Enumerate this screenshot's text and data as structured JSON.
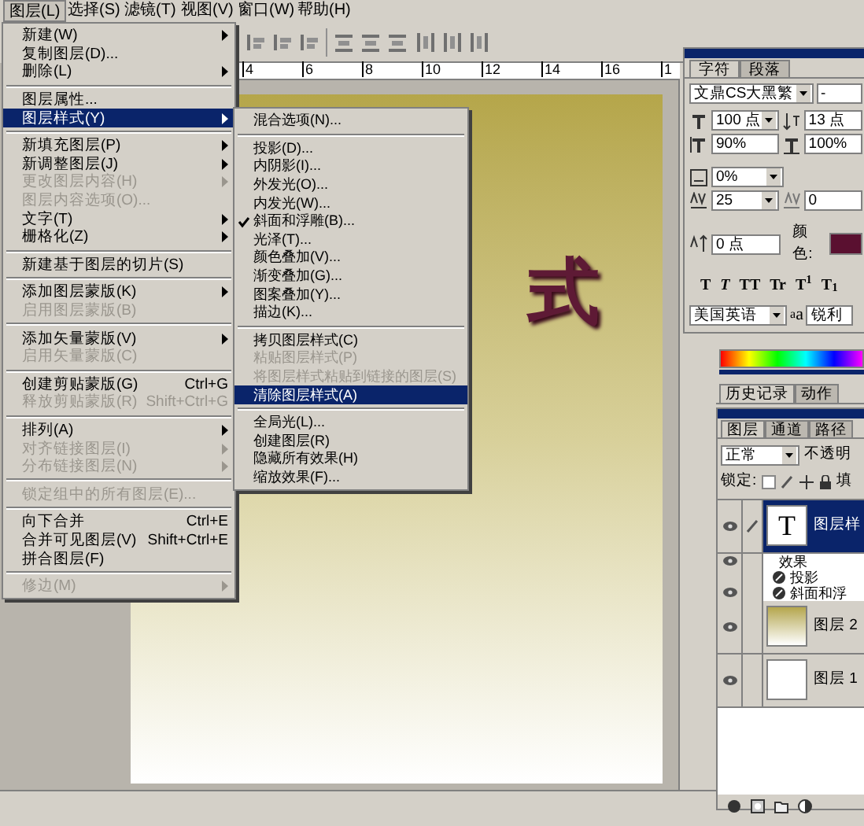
{
  "menu_bar": [
    {
      "label": "图层(L)",
      "selected": true
    },
    {
      "label": "选择(S)",
      "selected": false
    },
    {
      "label": "滤镜(T)",
      "selected": false
    },
    {
      "label": "视图(V)",
      "selected": false
    },
    {
      "label": "窗口(W)",
      "selected": false
    },
    {
      "label": "帮助(H)",
      "selected": false
    }
  ],
  "ruler": [
    "4",
    "6",
    "8",
    "10",
    "12",
    "14",
    "16",
    "1"
  ],
  "canvas": {
    "text": "式"
  },
  "layer_menu": [
    {
      "kind": "item",
      "label": "新建(W)",
      "submenu": true,
      "disabled": false,
      "selected": false
    },
    {
      "kind": "item",
      "label": "复制图层(D)...",
      "submenu": false,
      "disabled": false,
      "selected": false
    },
    {
      "kind": "item",
      "label": "删除(L)",
      "submenu": true,
      "disabled": false,
      "selected": false
    },
    {
      "kind": "separator"
    },
    {
      "kind": "item",
      "label": "图层属性...",
      "submenu": false,
      "disabled": false,
      "selected": false
    },
    {
      "kind": "item",
      "label": "图层样式(Y)",
      "submenu": true,
      "disabled": false,
      "selected": true
    },
    {
      "kind": "separator"
    },
    {
      "kind": "item",
      "label": "新填充图层(P)",
      "submenu": true,
      "disabled": false,
      "selected": false
    },
    {
      "kind": "item",
      "label": "新调整图层(J)",
      "submenu": true,
      "disabled": false,
      "selected": false
    },
    {
      "kind": "item",
      "label": "更改图层内容(H)",
      "submenu": true,
      "disabled": true,
      "selected": false
    },
    {
      "kind": "item",
      "label": "图层内容选项(O)...",
      "submenu": false,
      "disabled": true,
      "selected": false
    },
    {
      "kind": "item",
      "label": "文字(T)",
      "submenu": true,
      "disabled": false,
      "selected": false
    },
    {
      "kind": "item",
      "label": "栅格化(Z)",
      "submenu": true,
      "disabled": false,
      "selected": false
    },
    {
      "kind": "separator"
    },
    {
      "kind": "item",
      "label": "新建基于图层的切片(S)",
      "submenu": false,
      "disabled": false,
      "selected": false
    },
    {
      "kind": "separator"
    },
    {
      "kind": "item",
      "label": "添加图层蒙版(K)",
      "submenu": true,
      "disabled": false,
      "selected": false
    },
    {
      "kind": "item",
      "label": "启用图层蒙版(B)",
      "submenu": false,
      "disabled": true,
      "selected": false
    },
    {
      "kind": "separator"
    },
    {
      "kind": "item",
      "label": "添加矢量蒙版(V)",
      "submenu": true,
      "disabled": false,
      "selected": false
    },
    {
      "kind": "item",
      "label": "启用矢量蒙版(C)",
      "submenu": false,
      "disabled": true,
      "selected": false
    },
    {
      "kind": "separator"
    },
    {
      "kind": "item",
      "label": "创建剪贴蒙版(G)",
      "shortcut": "Ctrl+G",
      "submenu": false,
      "disabled": false,
      "selected": false
    },
    {
      "kind": "item",
      "label": "释放剪贴蒙版(R)",
      "shortcut": "Shift+Ctrl+G",
      "submenu": false,
      "disabled": true,
      "selected": false
    },
    {
      "kind": "separator"
    },
    {
      "kind": "item",
      "label": "排列(A)",
      "submenu": true,
      "disabled": false,
      "selected": false
    },
    {
      "kind": "item",
      "label": "对齐链接图层(I)",
      "submenu": true,
      "disabled": true,
      "selected": false
    },
    {
      "kind": "item",
      "label": "分布链接图层(N)",
      "submenu": true,
      "disabled": true,
      "selected": false
    },
    {
      "kind": "separator"
    },
    {
      "kind": "item",
      "label": "锁定组中的所有图层(E)...",
      "submenu": false,
      "disabled": true,
      "selected": false
    },
    {
      "kind": "separator"
    },
    {
      "kind": "item",
      "label": "向下合并",
      "shortcut": "Ctrl+E",
      "submenu": false,
      "disabled": false,
      "selected": false
    },
    {
      "kind": "item",
      "label": "合并可见图层(V)",
      "shortcut": "Shift+Ctrl+E",
      "submenu": false,
      "disabled": false,
      "selected": false
    },
    {
      "kind": "item",
      "label": "拼合图层(F)",
      "submenu": false,
      "disabled": false,
      "selected": false
    },
    {
      "kind": "separator"
    },
    {
      "kind": "item",
      "label": "修边(M)",
      "submenu": true,
      "disabled": true,
      "selected": false
    }
  ],
  "style_menu": [
    {
      "kind": "item",
      "label": "混合选项(N)...",
      "checked": false,
      "disabled": false,
      "selected": false
    },
    {
      "kind": "separator"
    },
    {
      "kind": "item",
      "label": "投影(D)...",
      "checked": false,
      "disabled": false,
      "selected": false
    },
    {
      "kind": "item",
      "label": "内阴影(I)...",
      "checked": false,
      "disabled": false,
      "selected": false
    },
    {
      "kind": "item",
      "label": "外发光(O)...",
      "checked": false,
      "disabled": false,
      "selected": false
    },
    {
      "kind": "item",
      "label": "内发光(W)...",
      "checked": false,
      "disabled": false,
      "selected": false
    },
    {
      "kind": "item",
      "label": "斜面和浮雕(B)...",
      "checked": true,
      "disabled": false,
      "selected": false
    },
    {
      "kind": "item",
      "label": "光泽(T)...",
      "checked": false,
      "disabled": false,
      "selected": false
    },
    {
      "kind": "item",
      "label": "颜色叠加(V)...",
      "checked": false,
      "disabled": false,
      "selected": false
    },
    {
      "kind": "item",
      "label": "渐变叠加(G)...",
      "checked": false,
      "disabled": false,
      "selected": false
    },
    {
      "kind": "item",
      "label": "图案叠加(Y)...",
      "checked": false,
      "disabled": false,
      "selected": false
    },
    {
      "kind": "item",
      "label": "描边(K)...",
      "checked": false,
      "disabled": false,
      "selected": false
    },
    {
      "kind": "separator"
    },
    {
      "kind": "item",
      "label": "拷贝图层样式(C)",
      "checked": false,
      "disabled": false,
      "selected": false
    },
    {
      "kind": "item",
      "label": "粘贴图层样式(P)",
      "checked": false,
      "disabled": true,
      "selected": false
    },
    {
      "kind": "item",
      "label": "将图层样式粘贴到链接的图层(S)",
      "checked": false,
      "disabled": true,
      "selected": false
    },
    {
      "kind": "item",
      "label": "清除图层样式(A)",
      "checked": false,
      "disabled": false,
      "selected": true
    },
    {
      "kind": "separator"
    },
    {
      "kind": "item",
      "label": "全局光(L)...",
      "checked": false,
      "disabled": false,
      "selected": false
    },
    {
      "kind": "item",
      "label": "创建图层(R)",
      "checked": false,
      "disabled": false,
      "selected": false
    },
    {
      "kind": "item",
      "label": "隐藏所有效果(H)",
      "checked": false,
      "disabled": false,
      "selected": false
    },
    {
      "kind": "item",
      "label": "缩放效果(F)...",
      "checked": false,
      "disabled": false,
      "selected": false
    }
  ],
  "character_panel": {
    "tabs": [
      {
        "label": "字符",
        "selected": true
      },
      {
        "label": "段落",
        "selected": false
      }
    ],
    "font": "文鼎CS大黑繁",
    "font_style": "-",
    "size": "100 点",
    "leading": "13 点",
    "vertical_scale": "90%",
    "horizontal_scale": "100%",
    "tracking_ratio": "0%",
    "kerning": "25",
    "tracking": "0",
    "baseline_shift": "0 点",
    "color_label": "颜色:",
    "color": "#5a1030",
    "style_buttons": [
      "T",
      "*T*",
      "TT",
      "Tr",
      "T$^{1}$",
      "T$_{1}$"
    ],
    "language": "美国英语",
    "antialias_icon": "a",
    "antialias_icon_small": "a",
    "antialias": "锐利"
  },
  "history_panel": {
    "tabs": [
      {
        "label": "历史记录",
        "selected": true
      },
      {
        "label": "动作",
        "selected": false
      }
    ]
  },
  "layers_panel": {
    "tabs": [
      {
        "label": "图层",
        "selected": true
      },
      {
        "label": "通道",
        "selected": false
      },
      {
        "label": "路径",
        "selected": false
      }
    ],
    "blend_mode": "正常",
    "opacity_label": "不透明",
    "lock_label": "锁定:",
    "fill_label": "填",
    "layers": [
      {
        "name": "图层样",
        "kind": "text",
        "thumb": "T",
        "selected": true,
        "visible": true,
        "effects_label": "效果",
        "effects_visible": true,
        "effects": [
          {
            "name": "投影",
            "visible": false
          },
          {
            "name": "斜面和浮",
            "visible": true
          }
        ]
      },
      {
        "name": "图层 2",
        "kind": "gradient",
        "selected": false,
        "visible": true
      },
      {
        "name": "图层 1",
        "kind": "fill",
        "selected": false,
        "visible": true
      }
    ]
  }
}
